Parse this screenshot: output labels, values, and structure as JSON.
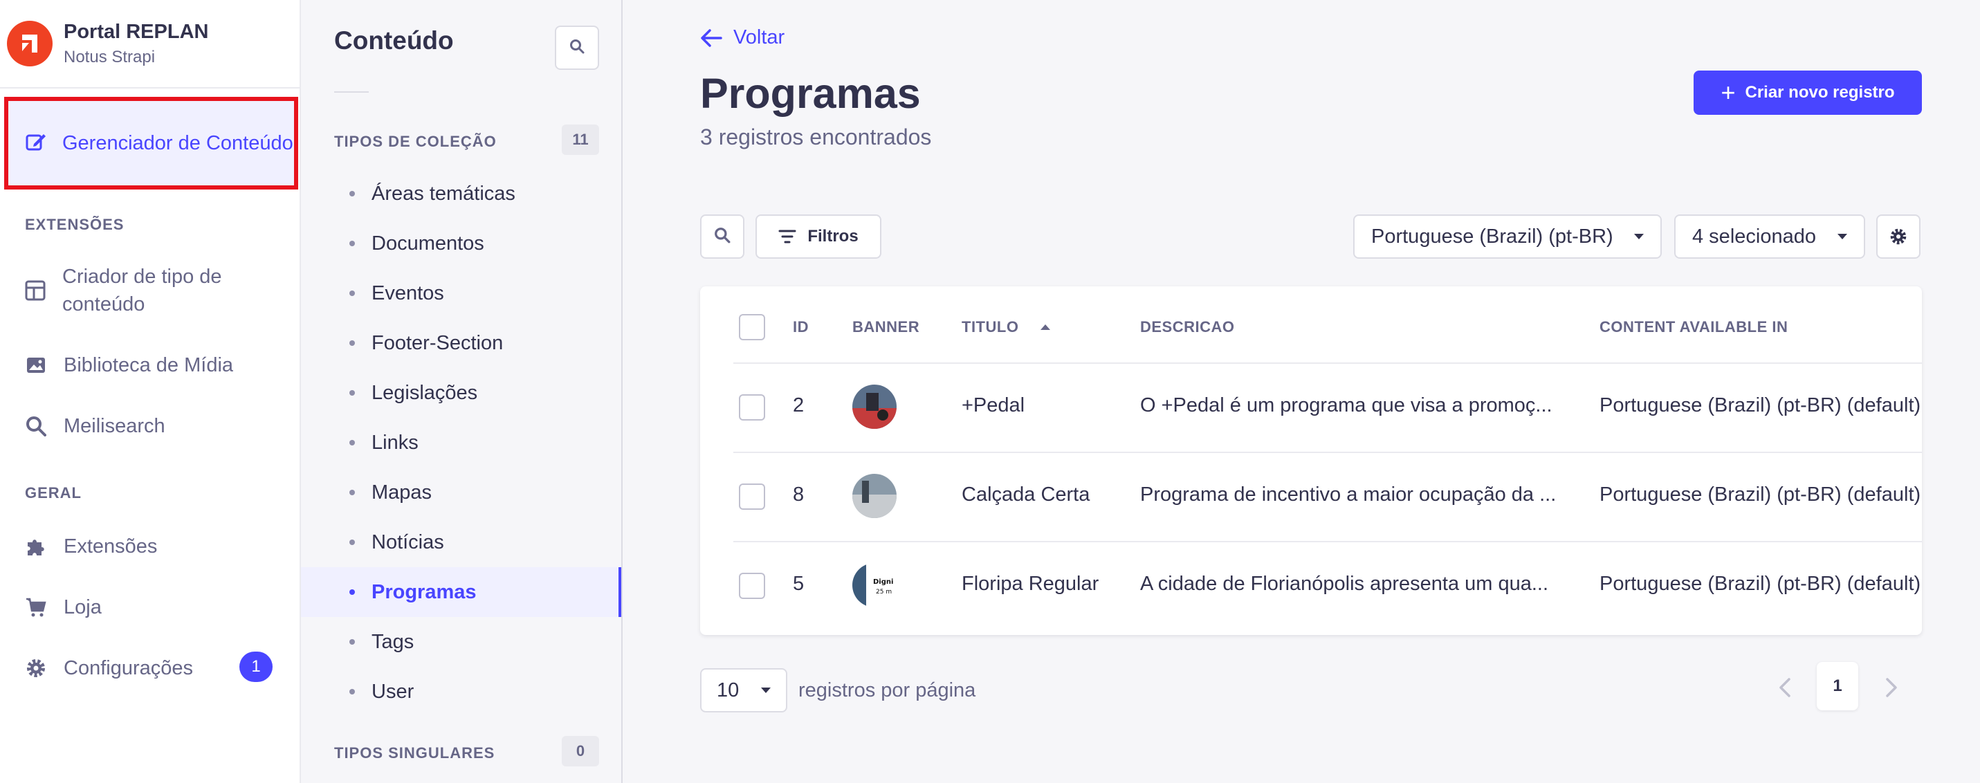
{
  "brand": {
    "title": "Portal REPLAN",
    "subtitle": "Notus Strapi"
  },
  "nav": {
    "active_item": "Gerenciador de Conteúdo",
    "sections": {
      "extensions": "EXTENSÕES",
      "general": "GERAL"
    },
    "items": {
      "type_builder": "Criador de tipo de conteúdo",
      "media_library": "Biblioteca de Mídia",
      "meilisearch": "Meilisearch",
      "plugins": "Extensões",
      "marketplace": "Loja",
      "settings": "Configurações"
    },
    "settings_badge": "1"
  },
  "subnav": {
    "title": "Conteúdo",
    "collection_header": "TIPOS DE COLEÇÃO",
    "collection_count": "11",
    "collection_types": [
      "Áreas temáticas",
      "Documentos",
      "Eventos",
      "Footer-Section",
      "Legislações",
      "Links",
      "Mapas",
      "Notícias",
      "Programas",
      "Tags",
      "User"
    ],
    "active_type": "Programas",
    "single_header": "TIPOS SINGULARES",
    "single_count": "0"
  },
  "header": {
    "back": "Voltar",
    "title": "Programas",
    "subtitle": "3 registros encontrados",
    "create_button": "Criar novo registro"
  },
  "toolbar": {
    "filters": "Filtros",
    "locale": "Portuguese (Brazil) (pt-BR)",
    "columns": "4 selecionado"
  },
  "table": {
    "headers": {
      "id": "ID",
      "banner": "BANNER",
      "titulo": "TITULO",
      "descricao": "DESCRICAO",
      "available": "CONTENT AVAILABLE IN"
    },
    "sort": {
      "column": "TITULO",
      "direction": "asc"
    },
    "rows": [
      {
        "id": "2",
        "titulo": "+Pedal",
        "descricao": "O +Pedal é um programa que visa a promoç...",
        "available": "Portuguese (Brazil) (pt-BR) (default)"
      },
      {
        "id": "8",
        "titulo": "Calçada Certa",
        "descricao": "Programa de incentivo a maior ocupação da ...",
        "available": "Portuguese (Brazil) (pt-BR) (default)"
      },
      {
        "id": "5",
        "titulo": "Floripa Regular",
        "descricao": "A cidade de Florianópolis apresenta um qua...",
        "available": "Portuguese (Brazil) (pt-BR) (default)"
      }
    ]
  },
  "pagination": {
    "page_size": "10",
    "page_size_label": "registros por página",
    "current_page": "1"
  },
  "colors": {
    "primary": "#4945ff",
    "highlight_border": "#e8131d",
    "brand": "#ef4123"
  }
}
